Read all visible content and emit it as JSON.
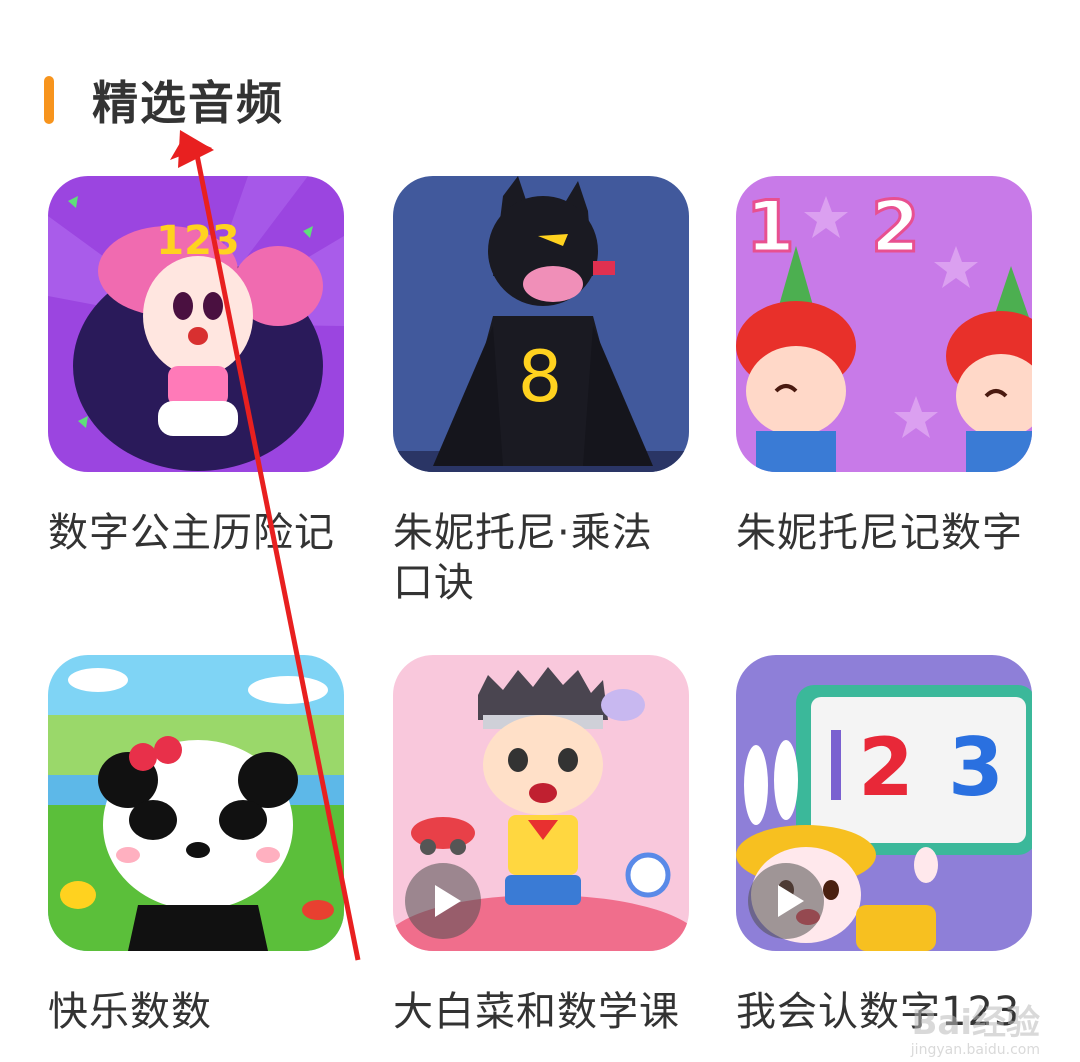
{
  "section": {
    "title": "精选音频",
    "accent_color": "#f7941d"
  },
  "items": [
    {
      "title": "数字公主历险记",
      "cover_icon": "princess-cover",
      "has_play_badge": false
    },
    {
      "title": "朱妮托尼·乘法口诀",
      "cover_icon": "bat-cover",
      "has_play_badge": false
    },
    {
      "title": "朱妮托尼记数字",
      "cover_icon": "twins-cover",
      "has_play_badge": false
    },
    {
      "title": "快乐数数",
      "cover_icon": "panda-cover",
      "has_play_badge": false
    },
    {
      "title": "大白菜和数学课",
      "cover_icon": "boy-cover",
      "has_play_badge": true
    },
    {
      "title": "我会认数字123",
      "cover_icon": "bunny-cover",
      "has_play_badge": true
    }
  ],
  "cover_text": {
    "princess_digits": "123",
    "bat_digit": "8",
    "twins_digits_1": "1",
    "twins_digits_2": "2",
    "bunny_digit_2": "2",
    "bunny_digit_3": "3"
  },
  "watermark": {
    "text": "Bai经验",
    "sub": "jingyan.baidu.com"
  }
}
